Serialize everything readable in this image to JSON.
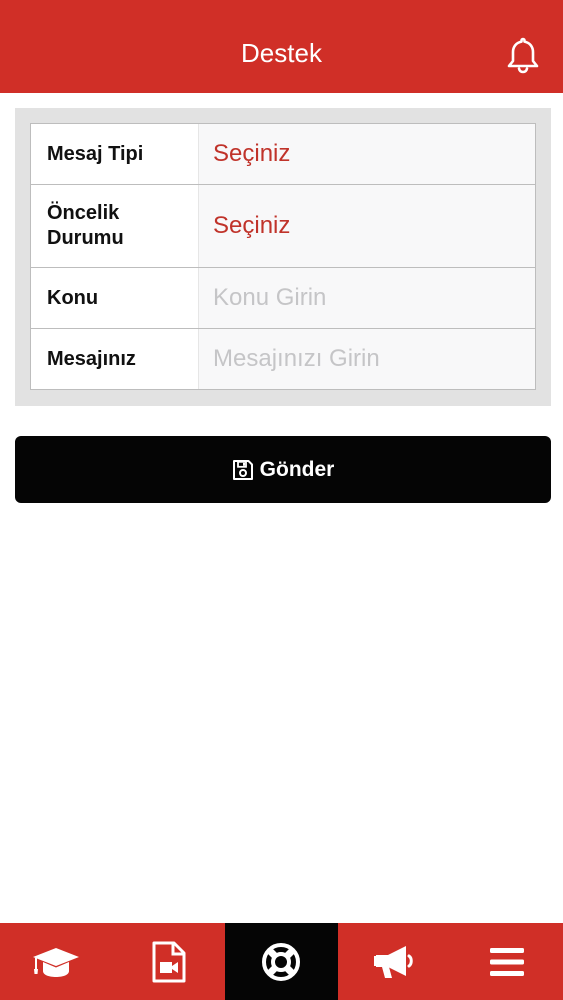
{
  "header": {
    "title": "Destek",
    "notification_icon": "bell-icon"
  },
  "form": {
    "rows": [
      {
        "label": "Mesaj Tipi",
        "value": "Seçiniz",
        "kind": "select"
      },
      {
        "label": "Öncelik Durumu",
        "value": "Seçiniz",
        "kind": "select"
      },
      {
        "label": "Konu",
        "placeholder": "Konu Girin",
        "value": "",
        "kind": "input"
      },
      {
        "label": "Mesajınız",
        "placeholder": "Mesajınızı Girin",
        "value": "",
        "kind": "input"
      }
    ]
  },
  "submit": {
    "label": "Gönder",
    "icon": "floppy-disk-icon"
  },
  "tabbar": {
    "tabs": [
      {
        "icon": "graduation-cap-icon",
        "active": false
      },
      {
        "icon": "video-file-icon",
        "active": false
      },
      {
        "icon": "life-ring-icon",
        "active": true
      },
      {
        "icon": "megaphone-icon",
        "active": false
      },
      {
        "icon": "menu-icon",
        "active": false
      }
    ]
  },
  "colors": {
    "brand_red": "#d02f27",
    "select_red": "#c0332a",
    "button_black": "#050505",
    "card_gray": "#e2e2e2"
  }
}
